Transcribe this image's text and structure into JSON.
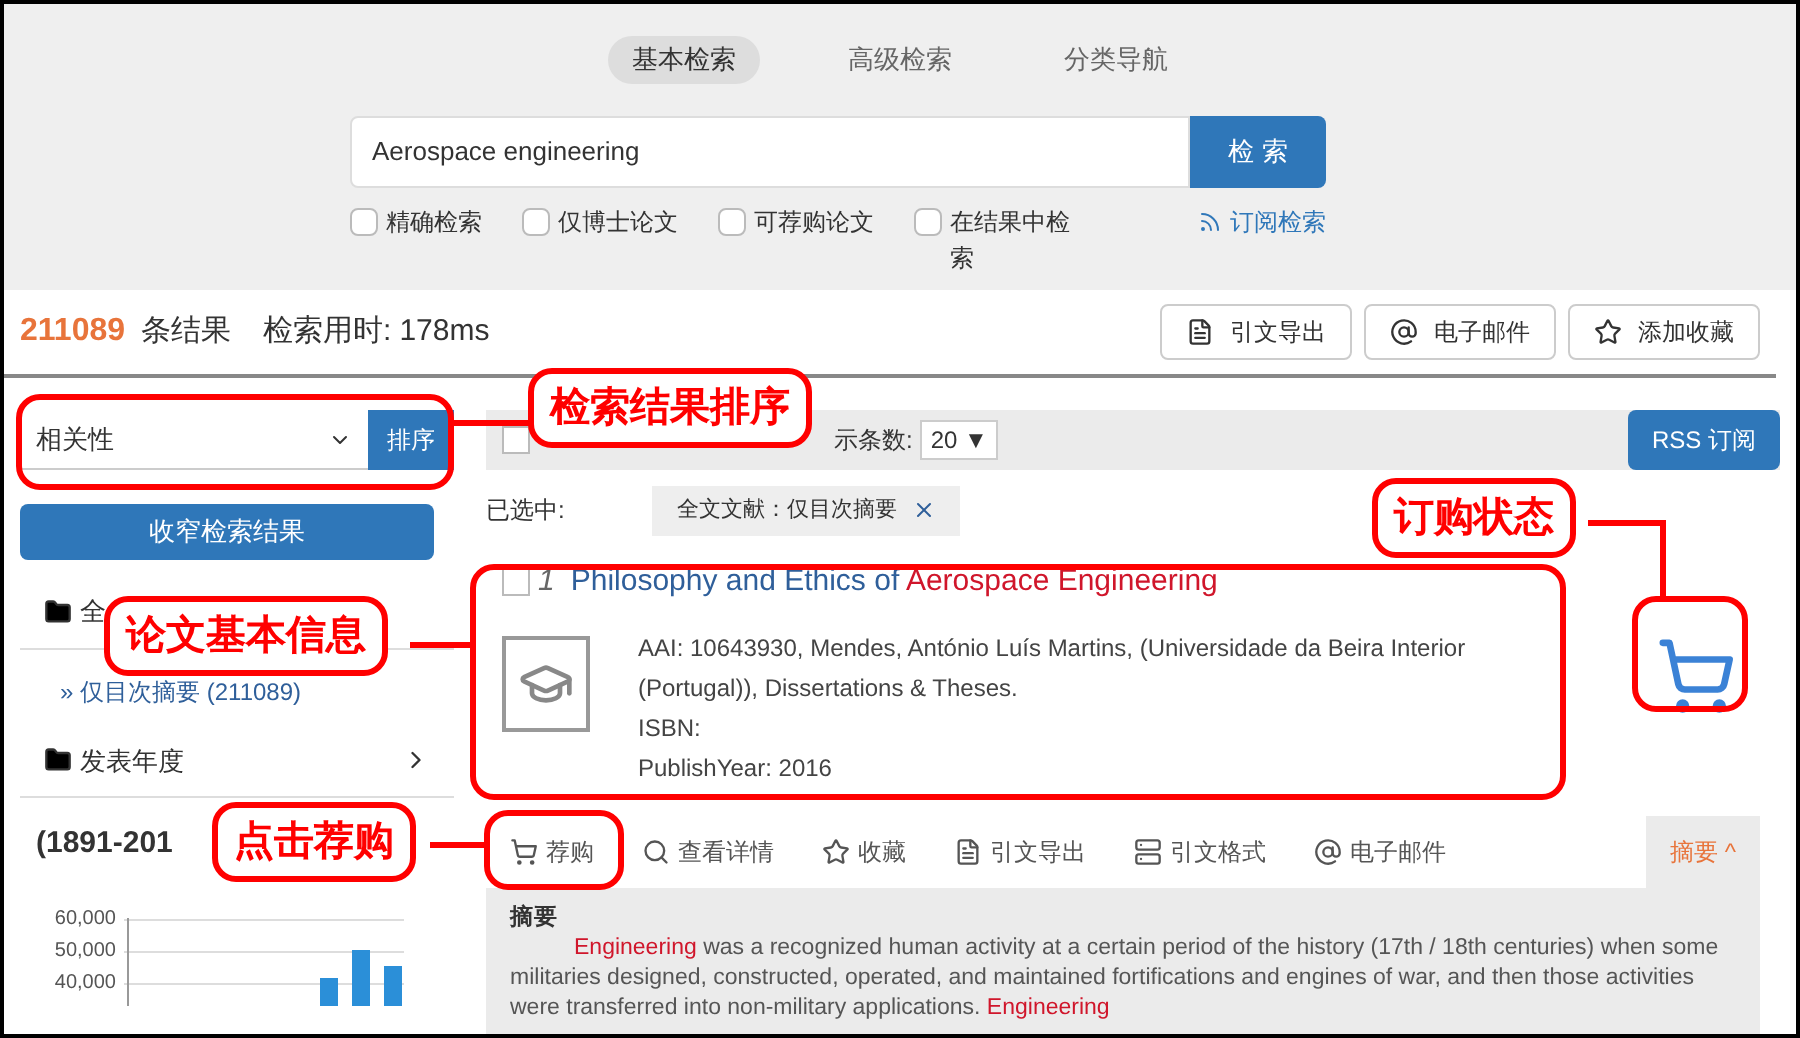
{
  "search_tabs": [
    {
      "label": "基本检索",
      "selected": true
    },
    {
      "label": "高级检索",
      "selected": false
    },
    {
      "label": "分类导航",
      "selected": false
    }
  ],
  "search": {
    "value": "Aerospace engineering",
    "button": "检 索"
  },
  "options": [
    {
      "label": "精确检索",
      "checked": false
    },
    {
      "label": "仅博士论文",
      "checked": false
    },
    {
      "label": "可荐购论文",
      "checked": false
    },
    {
      "label": "在结果中检索",
      "checked": false
    }
  ],
  "subscribe_link": "订阅检索",
  "summary": {
    "count": "211089",
    "count_label": "条结果",
    "time_label": "检索用时:",
    "time": "178ms"
  },
  "top_actions": [
    {
      "label": "引文导出",
      "kind": "export"
    },
    {
      "label": "电子邮件",
      "kind": "email"
    },
    {
      "label": "添加收藏",
      "kind": "star"
    }
  ],
  "sort": {
    "value": "相关性",
    "button": "排序"
  },
  "narrow_button": "收窄检索结果",
  "facets": [
    {
      "title": "全",
      "items": [
        {
          "label": "» 仅目次摘要",
          "count": "(211089)"
        }
      ]
    },
    {
      "title": "发表年度",
      "expandable": true
    }
  ],
  "year_chart": {
    "title": "(1891-201",
    "axis_labels": [
      "60,000",
      "50,000",
      "40,000"
    ]
  },
  "toolbar": {
    "page_size_label": "示条数:",
    "page_size": "20 ▼",
    "rss_button": "RSS 订阅",
    "select_all_checked": false
  },
  "selected_filters": {
    "label": "已选中:",
    "tags": [
      "全文文献：仅目次摘要"
    ]
  },
  "result": {
    "checked": false,
    "number": "1",
    "title": [
      {
        "text": "Philosophy and Ethics of ",
        "highlight": false
      },
      {
        "text": "Aerospace Engineering",
        "highlight": true
      }
    ],
    "lines": [
      "AAI: 10643930, Mendes, António Luís Martins, (Universidade da Beira Interior (Portugal)), Dissertations & Theses.",
      "ISBN:",
      "PublishYear: 2016"
    ],
    "actions": [
      {
        "label": "荐购",
        "kind": "cart"
      },
      {
        "label": "查看详情",
        "kind": "search"
      },
      {
        "label": "收藏",
        "kind": "star"
      },
      {
        "label": "引文导出",
        "kind": "export"
      },
      {
        "label": "引文格式",
        "kind": "format"
      },
      {
        "label": "电子邮件",
        "kind": "email"
      }
    ],
    "abstract_tab": {
      "label": "摘要 ^",
      "expanded": true
    },
    "abstract_title": "摘要",
    "abstract": [
      {
        "text": "Engineering",
        "highlight": true
      },
      {
        "text": " was a recognized human activity at a certain period of the history (17th / 18th centuries) when some militaries designed, constructed, operated, and maintained fortifications and engines of war, and then those activities were transferred into non-military applications. ",
        "highlight": false
      },
      {
        "text": "Engineering",
        "highlight": true
      }
    ]
  },
  "callouts": [
    "检索结果排序",
    "订购状态",
    "论文基本信息",
    "点击荐购"
  ]
}
